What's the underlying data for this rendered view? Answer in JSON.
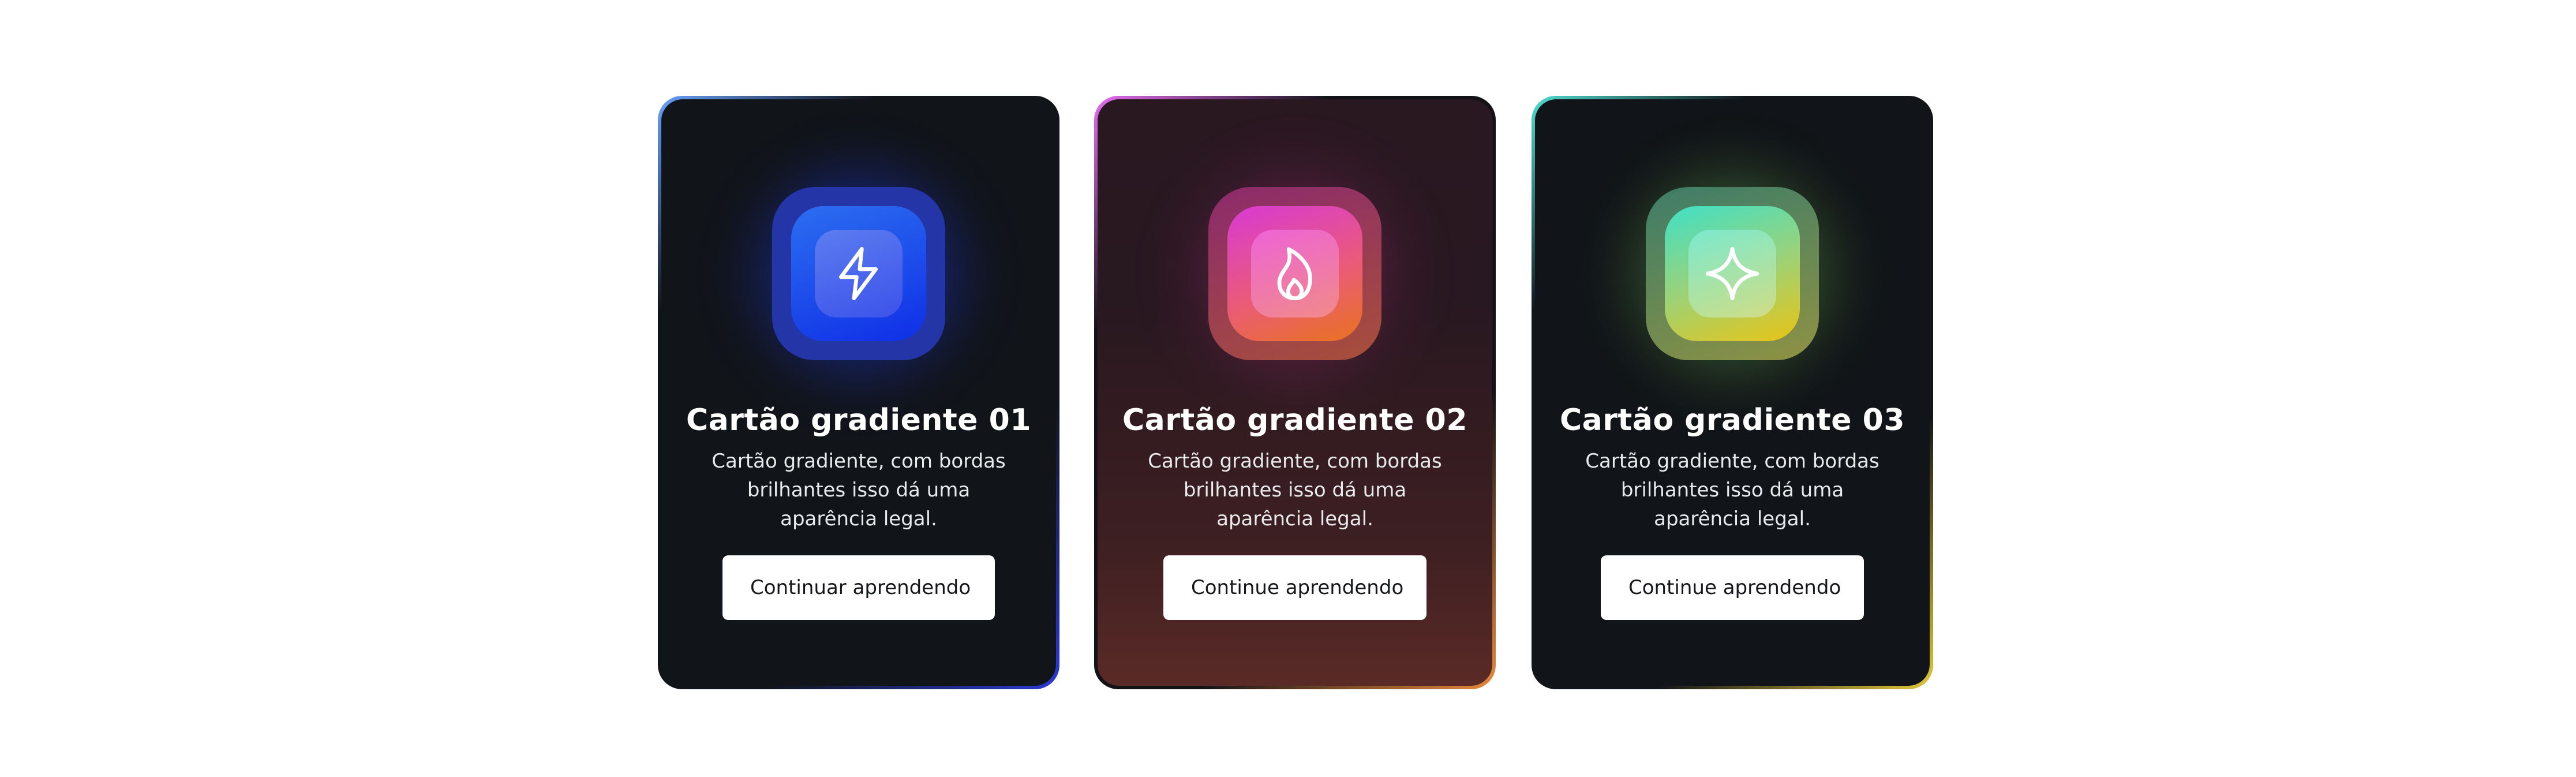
{
  "cards": [
    {
      "title": "Cartão gradiente 01",
      "description": "Cartão gradiente, com bordas brilhantes isso dá uma aparência legal.",
      "button_label": "Continuar aprendendo",
      "icon": "lightning-bolt-icon"
    },
    {
      "title": "Cartão gradiente 02",
      "description": "Cartão gradiente, com bordas brilhantes isso dá uma aparência legal.",
      "button_label": "Continue aprendendo",
      "icon": "flame-icon"
    },
    {
      "title": "Cartão gradiente 03",
      "description": "Cartão gradiente, com bordas brilhantes isso dá uma aparência legal.",
      "button_label": "Continue aprendendo",
      "icon": "sparkle-icon"
    }
  ],
  "colors": {
    "page_background": "#ffffff",
    "card_background": "#111418",
    "card1_accent_start": "#6aa2ff",
    "card1_accent_end": "#2c3ad6",
    "card2_accent_start": "#e86ef3",
    "card2_accent_end": "#e98a3b",
    "card3_accent_start": "#4fe0d1",
    "card3_accent_end": "#e2c83b",
    "button_background": "#ffffff",
    "button_text": "#15171a"
  }
}
